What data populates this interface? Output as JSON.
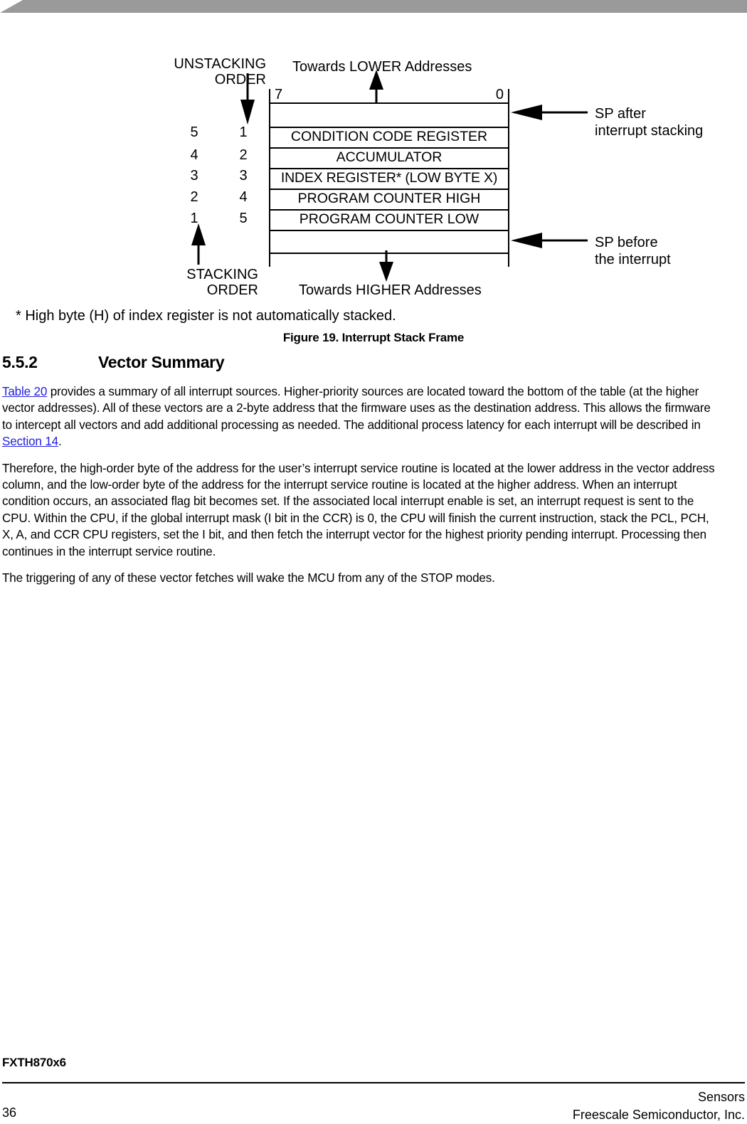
{
  "page": {
    "doc_id": "FXTH870x6",
    "page_number": "36",
    "footer_line1": "Sensors",
    "footer_line2": "Freescale Semiconductor, Inc."
  },
  "figure": {
    "caption": "Figure 19. Interrupt Stack Frame",
    "footnote": "* High byte (H) of index register is not automatically stacked.",
    "unstacking_label_line1": "UNSTACKING",
    "unstacking_label_line2": "ORDER",
    "stacking_label_line1": "STACKING",
    "stacking_label_line2": "ORDER",
    "towards_lower": "Towards LOWER Addresses",
    "towards_higher": "Towards HIGHER Addresses",
    "bit_msb": "7",
    "bit_lsb": "0",
    "sp_after_line1": "SP after",
    "sp_after_line2": "interrupt stacking",
    "sp_before_line1": "SP before",
    "sp_before_line2": "the interrupt",
    "unstacking_order": [
      "5",
      "4",
      "3",
      "2",
      "1"
    ],
    "stacking_order": [
      "1",
      "2",
      "3",
      "4",
      "5"
    ],
    "stack_rows": [
      {
        "label": "",
        "empty": true
      },
      {
        "label": "CONDITION CODE REGISTER",
        "empty": false
      },
      {
        "label": "ACCUMULATOR",
        "empty": false
      },
      {
        "label": "INDEX REGISTER* (LOW BYTE X)",
        "empty": false
      },
      {
        "label": "PROGRAM COUNTER HIGH",
        "empty": false
      },
      {
        "label": "PROGRAM COUNTER LOW",
        "empty": false
      },
      {
        "label": "",
        "empty": true
      }
    ]
  },
  "section": {
    "number": "5.5.2",
    "title": "Vector Summary"
  },
  "paragraphs": {
    "p1_link1": "Table 20",
    "p1_a": " provides a summary of all interrupt sources. Higher-priority sources are located toward the bottom of the table (at the higher vector addresses). All of these vectors are a 2-byte address that the firmware uses as the destination address. This allows the firmware to intercept all vectors and add additional processing as needed. The additional process latency for each interrupt will be described in ",
    "p1_link2": "Section 14",
    "p1_b": ".",
    "p2": "Therefore, the high-order byte of the address for the user’s interrupt service routine is located at the lower address in the vector address column, and the low-order byte of the address for the interrupt service routine is located at the higher address. When an interrupt condition occurs, an associated flag bit becomes set. If the associated local interrupt enable is set, an interrupt request is sent to the CPU. Within the CPU, if the global interrupt mask (I bit in the CCR) is 0, the CPU will finish the current instruction, stack the PCL, PCH, X, A, and CCR CPU registers, set the I bit, and then fetch the interrupt vector for the highest priority pending interrupt. Processing then continues in the interrupt service routine.",
    "p3": "The triggering of any of these vector fetches will wake the MCU from any of the STOP modes."
  },
  "colors": {
    "banner": "#9a9a9a",
    "link": "#2222dd",
    "text": "#000000"
  }
}
